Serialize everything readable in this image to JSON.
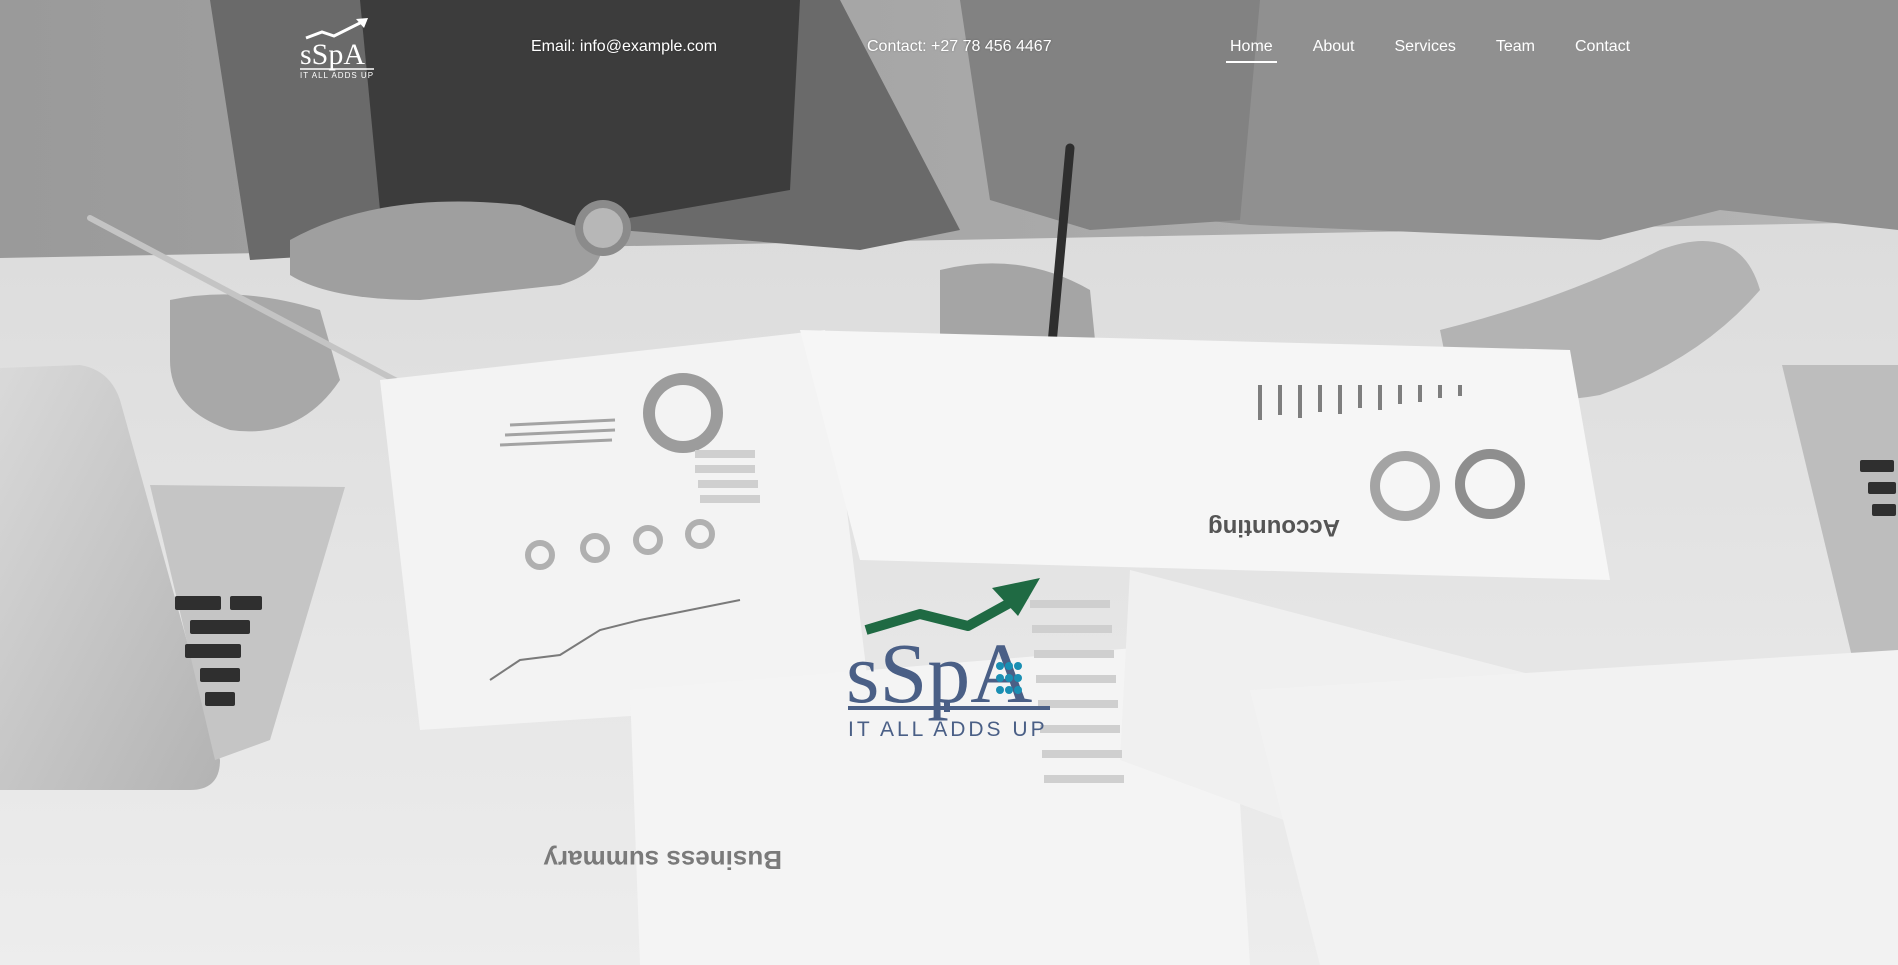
{
  "brand": {
    "logo_text": "sSpA",
    "tagline": "IT ALL ADDS UP",
    "colors": {
      "navy": "#4a5f86",
      "green": "#1f6a43",
      "teal": "#1a8fb3",
      "white": "#ffffff"
    }
  },
  "header": {
    "email_text": "Email: info@example.com",
    "phone_text": "Contact: +27 78 456 4467"
  },
  "nav": {
    "items": [
      {
        "label": "Home",
        "active": true
      },
      {
        "label": "About",
        "active": false
      },
      {
        "label": "Services",
        "active": false
      },
      {
        "label": "Team",
        "active": false
      },
      {
        "label": "Contact",
        "active": false
      }
    ]
  },
  "hero": {
    "background": "grayscale photo of two people working on financial charts and documents on a desk",
    "printed_text": {
      "accounting": "Accounting",
      "business_summary": "Business summary"
    }
  }
}
